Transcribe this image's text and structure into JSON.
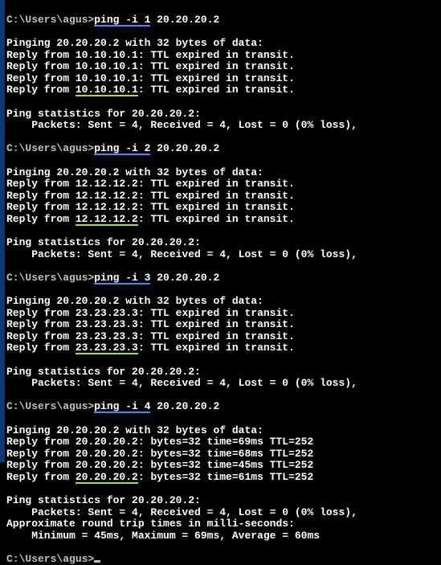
{
  "prompt_path": "C:\\Users\\agus>",
  "blank": "",
  "cmd": {
    "c1a": "ping -i 1",
    "c2a": "ping -i 2",
    "c3a": "ping -i 3",
    "c4a": "ping -i 4",
    "target": " 20.20.20.2"
  },
  "b1": {
    "header": "Pinging 20.20.20.2 with 32 bytes of data:",
    "rpre": "Reply from ",
    "rip": "10.10.10.1",
    "rsuf": ": TTL expired in transit.",
    "stat1": "Ping statistics for 20.20.20.2:",
    "stat2": "    Packets: Sent = 4, Received = 4, Lost = 0 (0% loss),"
  },
  "b2": {
    "header": "Pinging 20.20.20.2 with 32 bytes of data:",
    "rpre": "Reply from ",
    "rip": "12.12.12.2",
    "rsuf": ": TTL expired in transit.",
    "stat1": "Ping statistics for 20.20.20.2:",
    "stat2": "    Packets: Sent = 4, Received = 4, Lost = 0 (0% loss),"
  },
  "b3": {
    "header": "Pinging 20.20.20.2 with 32 bytes of data:",
    "rpre": "Reply from ",
    "rip": "23.23.23.3",
    "rsuf": ": TTL expired in transit.",
    "stat1": "Ping statistics for 20.20.20.2:",
    "stat2": "    Packets: Sent = 4, Received = 4, Lost = 0 (0% loss),"
  },
  "b4": {
    "header": "Pinging 20.20.20.2 with 32 bytes of data:",
    "rpre": "Reply from ",
    "rip": "20.20.20.2",
    "r1suf": ": bytes=32 time=69ms TTL=252",
    "r2suf": ": bytes=32 time=68ms TTL=252",
    "r3suf": ": bytes=32 time=45ms TTL=252",
    "r4suf": ": bytes=32 time=61ms TTL=252",
    "stat1": "Ping statistics for 20.20.20.2:",
    "stat2": "    Packets: Sent = 4, Received = 4, Lost = 0 (0% loss),",
    "stat3": "Approximate round trip times in milli-seconds:",
    "stat4": "    Minimum = 45ms, Maximum = 69ms, Average = 60ms"
  }
}
